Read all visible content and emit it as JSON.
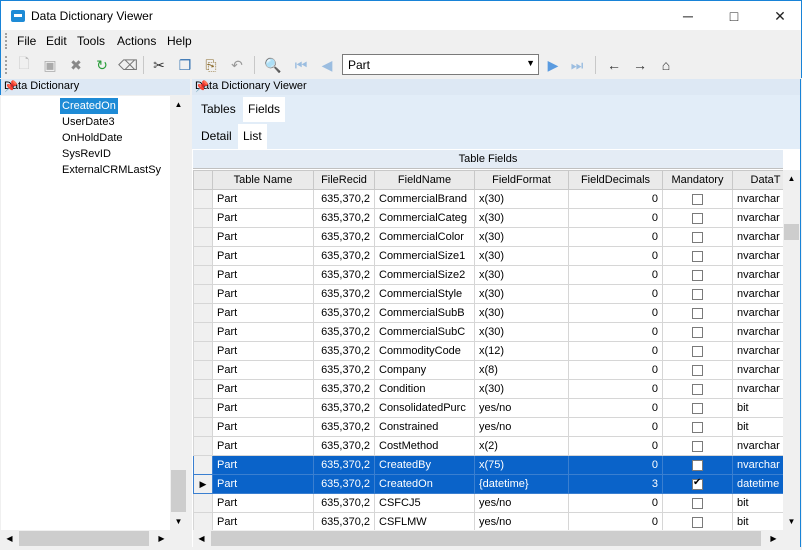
{
  "window": {
    "title": "Data Dictionary Viewer"
  },
  "menu": [
    "File",
    "Edit",
    "Tools",
    "Actions",
    "Help"
  ],
  "toolbar": {
    "table_combo_value": "Part"
  },
  "left_panel": {
    "title": "Data Dictionary",
    "tree_items": [
      {
        "label": "CreatedOn",
        "selected": true
      },
      {
        "label": "UserDate3",
        "selected": false
      },
      {
        "label": "OnHoldDate",
        "selected": false
      },
      {
        "label": "SysRevID",
        "selected": false
      },
      {
        "label": "ExternalCRMLastSy",
        "selected": false
      }
    ]
  },
  "right_panel": {
    "title": "Data Dictionary Viewer",
    "tabs_top": [
      "Tables",
      "Fields"
    ],
    "active_top_tab": "Fields",
    "tabs_sub": [
      "Detail",
      "List"
    ],
    "active_sub_tab": "List",
    "grid": {
      "caption": "Table Fields",
      "columns": [
        "Table Name",
        "FileRecid",
        "FieldName",
        "FieldFormat",
        "FieldDecimals",
        "Mandatory",
        "DataT"
      ],
      "rows": [
        {
          "table": "Part",
          "recid": "635,370,2",
          "field": "CommercialBrand",
          "format": "x(30)",
          "decimals": "0",
          "mandatory": false,
          "type": "nvarchar"
        },
        {
          "table": "Part",
          "recid": "635,370,2",
          "field": "CommercialCateg",
          "format": "x(30)",
          "decimals": "0",
          "mandatory": false,
          "type": "nvarchar"
        },
        {
          "table": "Part",
          "recid": "635,370,2",
          "field": "CommercialColor",
          "format": "x(30)",
          "decimals": "0",
          "mandatory": false,
          "type": "nvarchar"
        },
        {
          "table": "Part",
          "recid": "635,370,2",
          "field": "CommercialSize1",
          "format": "x(30)",
          "decimals": "0",
          "mandatory": false,
          "type": "nvarchar"
        },
        {
          "table": "Part",
          "recid": "635,370,2",
          "field": "CommercialSize2",
          "format": "x(30)",
          "decimals": "0",
          "mandatory": false,
          "type": "nvarchar"
        },
        {
          "table": "Part",
          "recid": "635,370,2",
          "field": "CommercialStyle",
          "format": "x(30)",
          "decimals": "0",
          "mandatory": false,
          "type": "nvarchar"
        },
        {
          "table": "Part",
          "recid": "635,370,2",
          "field": "CommercialSubB",
          "format": "x(30)",
          "decimals": "0",
          "mandatory": false,
          "type": "nvarchar"
        },
        {
          "table": "Part",
          "recid": "635,370,2",
          "field": "CommercialSubC",
          "format": "x(30)",
          "decimals": "0",
          "mandatory": false,
          "type": "nvarchar"
        },
        {
          "table": "Part",
          "recid": "635,370,2",
          "field": "CommodityCode",
          "format": "x(12)",
          "decimals": "0",
          "mandatory": false,
          "type": "nvarchar"
        },
        {
          "table": "Part",
          "recid": "635,370,2",
          "field": "Company",
          "format": "x(8)",
          "decimals": "0",
          "mandatory": false,
          "type": "nvarchar"
        },
        {
          "table": "Part",
          "recid": "635,370,2",
          "field": "Condition",
          "format": "x(30)",
          "decimals": "0",
          "mandatory": false,
          "type": "nvarchar"
        },
        {
          "table": "Part",
          "recid": "635,370,2",
          "field": "ConsolidatedPurc",
          "format": "yes/no",
          "decimals": "0",
          "mandatory": false,
          "type": "bit"
        },
        {
          "table": "Part",
          "recid": "635,370,2",
          "field": "Constrained",
          "format": "yes/no",
          "decimals": "0",
          "mandatory": false,
          "type": "bit"
        },
        {
          "table": "Part",
          "recid": "635,370,2",
          "field": "CostMethod",
          "format": "x(2)",
          "decimals": "0",
          "mandatory": false,
          "type": "nvarchar"
        },
        {
          "table": "Part",
          "recid": "635,370,2",
          "field": "CreatedBy",
          "format": "x(75)",
          "decimals": "0",
          "mandatory": false,
          "type": "nvarchar",
          "highlight": true
        },
        {
          "table": "Part",
          "recid": "635,370,2",
          "field": "CreatedOn",
          "format": "{datetime}",
          "decimals": "3",
          "mandatory": true,
          "type": "datetime",
          "highlight": true,
          "current": true
        },
        {
          "table": "Part",
          "recid": "635,370,2",
          "field": "CSFCJ5",
          "format": "yes/no",
          "decimals": "0",
          "mandatory": false,
          "type": "bit"
        },
        {
          "table": "Part",
          "recid": "635,370,2",
          "field": "CSFLMW",
          "format": "yes/no",
          "decimals": "0",
          "mandatory": false,
          "type": "bit"
        }
      ]
    }
  },
  "colors": {
    "accent": "#1e8bd6",
    "selection": "#0a63c9",
    "panel_header": "#dde8f4"
  }
}
